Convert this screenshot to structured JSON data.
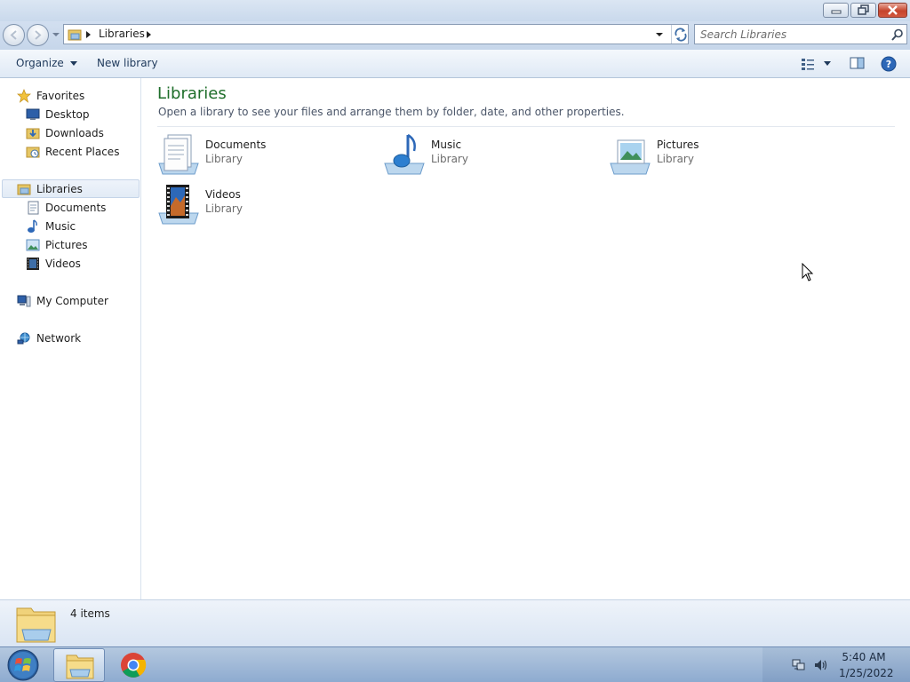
{
  "window": {
    "controls": {
      "minimize": "minimize-icon",
      "maximize": "restore-icon",
      "close": "close-icon"
    }
  },
  "address_bar": {
    "crumbs": [
      "Libraries"
    ],
    "search_placeholder": "Search Libraries"
  },
  "toolbar": {
    "organize_label": "Organize",
    "new_library_label": "New library"
  },
  "sidebar": {
    "favorites": {
      "label": "Favorites",
      "items": [
        {
          "label": "Desktop",
          "icon": "desktop-icon"
        },
        {
          "label": "Downloads",
          "icon": "downloads-icon"
        },
        {
          "label": "Recent Places",
          "icon": "recent-places-icon"
        }
      ]
    },
    "libraries": {
      "label": "Libraries",
      "selected": true,
      "items": [
        {
          "label": "Documents",
          "icon": "documents-icon"
        },
        {
          "label": "Music",
          "icon": "music-icon"
        },
        {
          "label": "Pictures",
          "icon": "pictures-icon"
        },
        {
          "label": "Videos",
          "icon": "videos-icon"
        }
      ]
    },
    "computer": {
      "label": "My Computer"
    },
    "network": {
      "label": "Network"
    }
  },
  "content": {
    "title": "Libraries",
    "subtitle": "Open a library to see your files and arrange them by folder, date, and other properties.",
    "tiles": [
      {
        "name": "Documents",
        "type": "Library",
        "icon": "documents-library-icon"
      },
      {
        "name": "Music",
        "type": "Library",
        "icon": "music-library-icon"
      },
      {
        "name": "Pictures",
        "type": "Library",
        "icon": "pictures-library-icon"
      },
      {
        "name": "Videos",
        "type": "Library",
        "icon": "videos-library-icon"
      }
    ]
  },
  "status": {
    "count": "4 items"
  },
  "taskbar": {
    "time": "5:40 AM",
    "date": "1/25/2022",
    "apps": [
      "windows-explorer",
      "google-chrome"
    ]
  },
  "colors": {
    "title_green": "#1e6e2a",
    "link_blue": "#1e395b",
    "close_red": "#c5442c",
    "selection": "#e2ebf6"
  }
}
